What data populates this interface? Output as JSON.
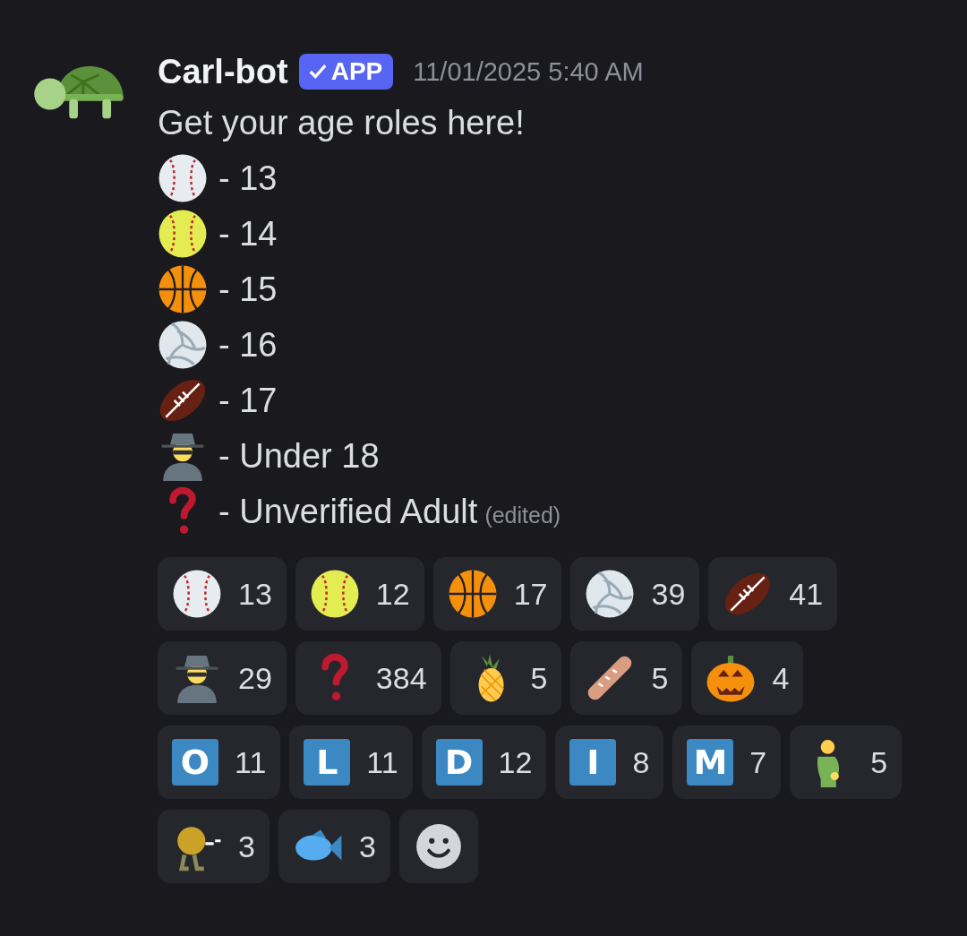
{
  "message": {
    "author": "Carl-bot",
    "badge": {
      "label": "APP",
      "verified": true
    },
    "timestamp": "11/01/2025 5:40 AM",
    "text": "Get your age roles here!",
    "lines": [
      {
        "kind": "baseball",
        "text": "- 13"
      },
      {
        "kind": "softball",
        "text": "- 14"
      },
      {
        "kind": "basketball",
        "text": "- 15"
      },
      {
        "kind": "volleyball",
        "text": "- 16"
      },
      {
        "kind": "football",
        "text": "- 17"
      },
      {
        "kind": "detective",
        "text": "- Under 18"
      },
      {
        "kind": "question",
        "text": "- Unverified Adult",
        "edited": "(edited)"
      }
    ]
  },
  "reactions": [
    {
      "kind": "baseball",
      "count": "13"
    },
    {
      "kind": "softball",
      "count": "12"
    },
    {
      "kind": "basketball",
      "count": "17"
    },
    {
      "kind": "volleyball",
      "count": "39"
    },
    {
      "kind": "football",
      "count": "41"
    },
    {
      "kind": "detective",
      "count": "29"
    },
    {
      "kind": "question",
      "count": "384"
    },
    {
      "kind": "pineapple",
      "count": "5"
    },
    {
      "kind": "bread",
      "count": "5"
    },
    {
      "kind": "pumpkin",
      "count": "4"
    },
    {
      "kind": "letter",
      "letter": "O",
      "count": "11"
    },
    {
      "kind": "letter",
      "letter": "L",
      "count": "11"
    },
    {
      "kind": "letter",
      "letter": "D",
      "count": "12"
    },
    {
      "kind": "letter",
      "letter": "I",
      "count": "8"
    },
    {
      "kind": "letter",
      "letter": "M",
      "count": "7"
    },
    {
      "kind": "figure",
      "count": "5"
    },
    {
      "kind": "blob",
      "count": "3"
    },
    {
      "kind": "fish",
      "count": "3"
    },
    {
      "kind": "add"
    }
  ]
}
